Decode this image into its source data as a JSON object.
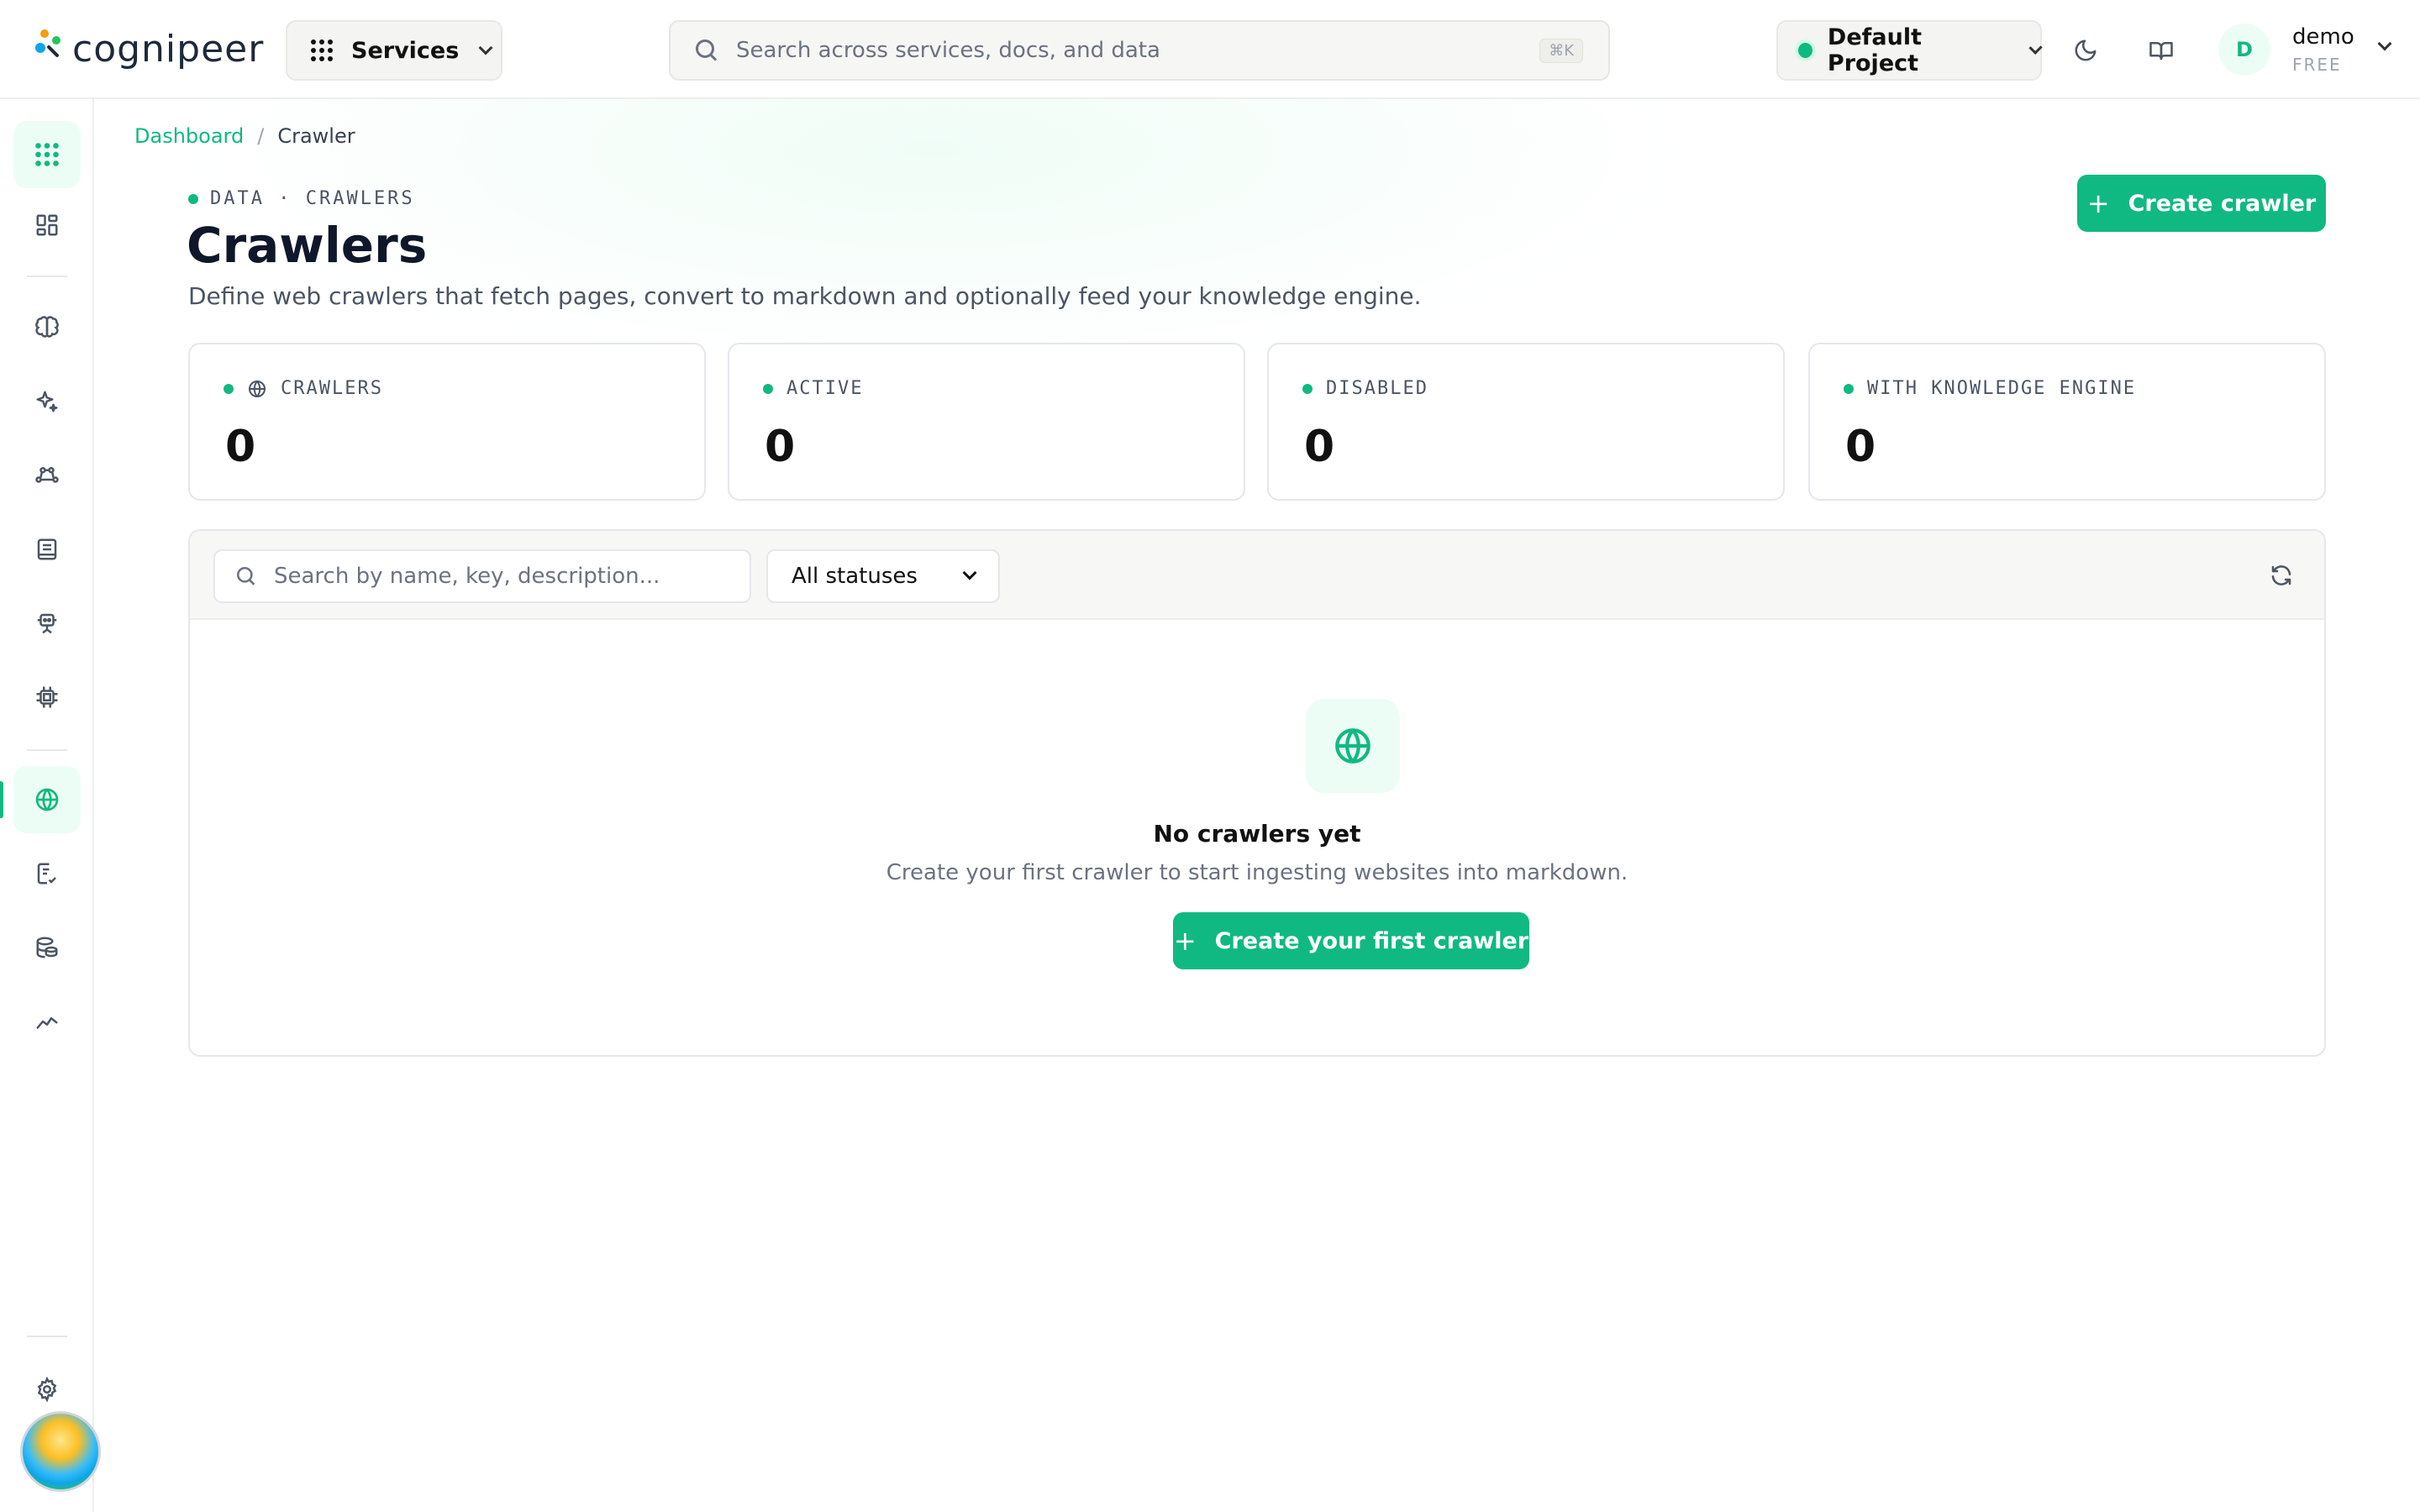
{
  "header": {
    "logo_text": "cognipeer",
    "services_label": "Services",
    "search_placeholder": "Search across services, docs, and data",
    "search_shortcut": "⌘K",
    "project_label": "Default Project",
    "user_initial": "D",
    "user_name": "demo",
    "user_plan": "FREE"
  },
  "sidebar": {
    "items": [
      {
        "name": "apps-grid-icon"
      },
      {
        "name": "dashboard-icon"
      },
      {
        "name": "brain-icon"
      },
      {
        "name": "sparkles-icon"
      },
      {
        "name": "workflow-icon"
      },
      {
        "name": "book-icon"
      },
      {
        "name": "robot-icon"
      },
      {
        "name": "chip-icon"
      },
      {
        "name": "globe-icon",
        "current": true
      },
      {
        "name": "checklist-icon"
      },
      {
        "name": "database-icon"
      },
      {
        "name": "analytics-icon"
      },
      {
        "name": "gear-icon"
      }
    ]
  },
  "breadcrumb": {
    "root": "Dashboard",
    "separator": "/",
    "current": "Crawler"
  },
  "page": {
    "eyebrow": "DATA · CRAWLERS",
    "title": "Crawlers",
    "description": "Define web crawlers that fetch pages, convert to markdown and optionally feed your knowledge engine.",
    "create_button": "Create crawler"
  },
  "stats": [
    {
      "label": "CRAWLERS",
      "value": "0",
      "icon": "globe-icon"
    },
    {
      "label": "ACTIVE",
      "value": "0"
    },
    {
      "label": "DISABLED",
      "value": "0"
    },
    {
      "label": "WITH KNOWLEDGE ENGINE",
      "value": "0"
    }
  ],
  "filters": {
    "search_placeholder": "Search by name, key, description...",
    "status_selected": "All statuses"
  },
  "empty_state": {
    "title": "No crawlers yet",
    "subtitle": "Create your first crawler to start ingesting websites into markdown.",
    "button": "Create your first crawler"
  },
  "colors": {
    "accent": "#10b981",
    "accent_soft": "#ecfdf5"
  }
}
